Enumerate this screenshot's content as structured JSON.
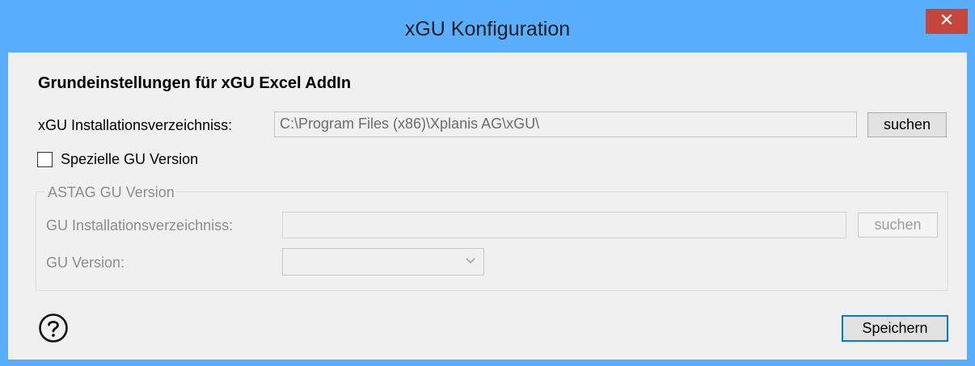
{
  "window": {
    "title": "xGU Konfiguration",
    "close_symbol": "✕"
  },
  "main": {
    "heading": "Grundeinstellungen für xGU Excel AddIn",
    "install_dir_label": "xGU Installationsverzeichniss:",
    "install_dir_value": "C:\\Program Files (x86)\\Xplanis AG\\xGU\\",
    "search_button": "suchen",
    "special_version_label": "Spezielle GU Version",
    "special_version_checked": false
  },
  "astag_group": {
    "legend": "ASTAG GU Version",
    "install_dir_label": "GU Installationsverzeichniss:",
    "install_dir_value": "",
    "search_button": "suchen",
    "version_label": "GU Version:",
    "version_value": ""
  },
  "footer": {
    "save_button": "Speichern",
    "help_icon": "help-circle-icon"
  }
}
